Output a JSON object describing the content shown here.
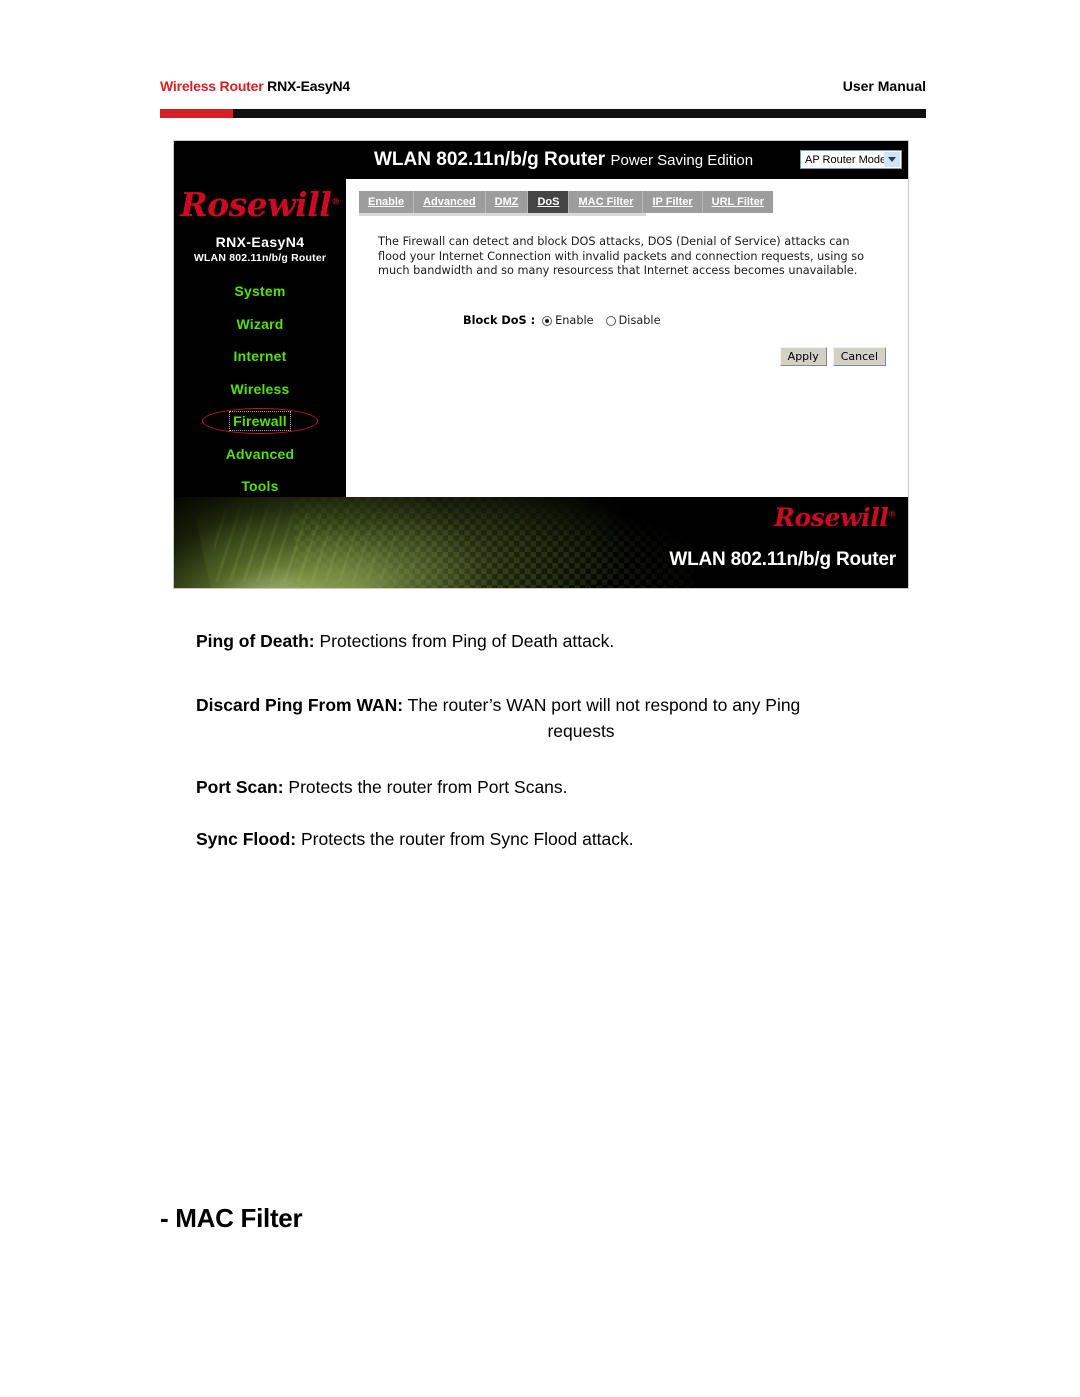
{
  "page_header": {
    "brand": "Wireless Router",
    "model": "RNX-EasyN4",
    "right_label": "User Manual"
  },
  "router_ui": {
    "title_bold": "WLAN 802.11n/b/g Router",
    "title_light": "Power Saving Edition",
    "mode_select": {
      "value": "AP Router Mode",
      "caret_icon": "chevron-down-icon"
    },
    "sidebar": {
      "logo": "Rosewill",
      "logo_reg": "®",
      "model": "RNX-EasyN4",
      "subtitle": "WLAN 802.11n/b/g Router",
      "items": [
        {
          "label": "System",
          "active": false
        },
        {
          "label": "Wizard",
          "active": false
        },
        {
          "label": "Internet",
          "active": false
        },
        {
          "label": "Wireless",
          "active": false
        },
        {
          "label": "Firewall",
          "active": true
        },
        {
          "label": "Advanced",
          "active": false
        },
        {
          "label": "Tools",
          "active": false
        }
      ]
    },
    "tabs": [
      {
        "label": "Enable",
        "active": false
      },
      {
        "label": "Advanced",
        "active": false
      },
      {
        "label": "DMZ",
        "active": false
      },
      {
        "label": "DoS",
        "active": true
      },
      {
        "label": "MAC Filter",
        "active": false
      },
      {
        "label": "IP Filter",
        "active": false
      },
      {
        "label": "URL Filter",
        "active": false
      }
    ],
    "description": "The Firewall can detect and block DOS attacks, DOS (Denial of Service) attacks can flood your Internet Connection with invalid packets and connection requests, using so much bandwidth and so many resourcess that Internet access becomes unavailable.",
    "form": {
      "label": "Block DoS :",
      "options": [
        {
          "label": "Enable",
          "selected": true
        },
        {
          "label": "Disable",
          "selected": false
        }
      ]
    },
    "buttons": {
      "apply": "Apply",
      "cancel": "Cancel"
    },
    "footer": {
      "logo": "Rosewill",
      "logo_reg": "®",
      "title": "WLAN 802.11n/b/g Router"
    }
  },
  "body": {
    "paragraphs": [
      {
        "term": "Ping of Death:",
        "text": " Protections from Ping of Death attack.",
        "second_line": ""
      },
      {
        "term": "Discard Ping From WAN:",
        "text": " The router’s WAN port will not respond to any Ping",
        "second_line": "requests"
      },
      {
        "term": "Port Scan:",
        "text": " Protects the router from Port Scans.",
        "second_line": ""
      },
      {
        "term": "Sync Flood:",
        "text": " Protects the router from Sync Flood attack.",
        "second_line": ""
      }
    ]
  },
  "section_heading": "- MAC Filter",
  "colors": {
    "brand_red": "#d71f28",
    "logo_red": "#cc0b22",
    "menu_green": "#55e00b",
    "tab_gray": "#9d9d9d",
    "tab_active": "#454545"
  }
}
